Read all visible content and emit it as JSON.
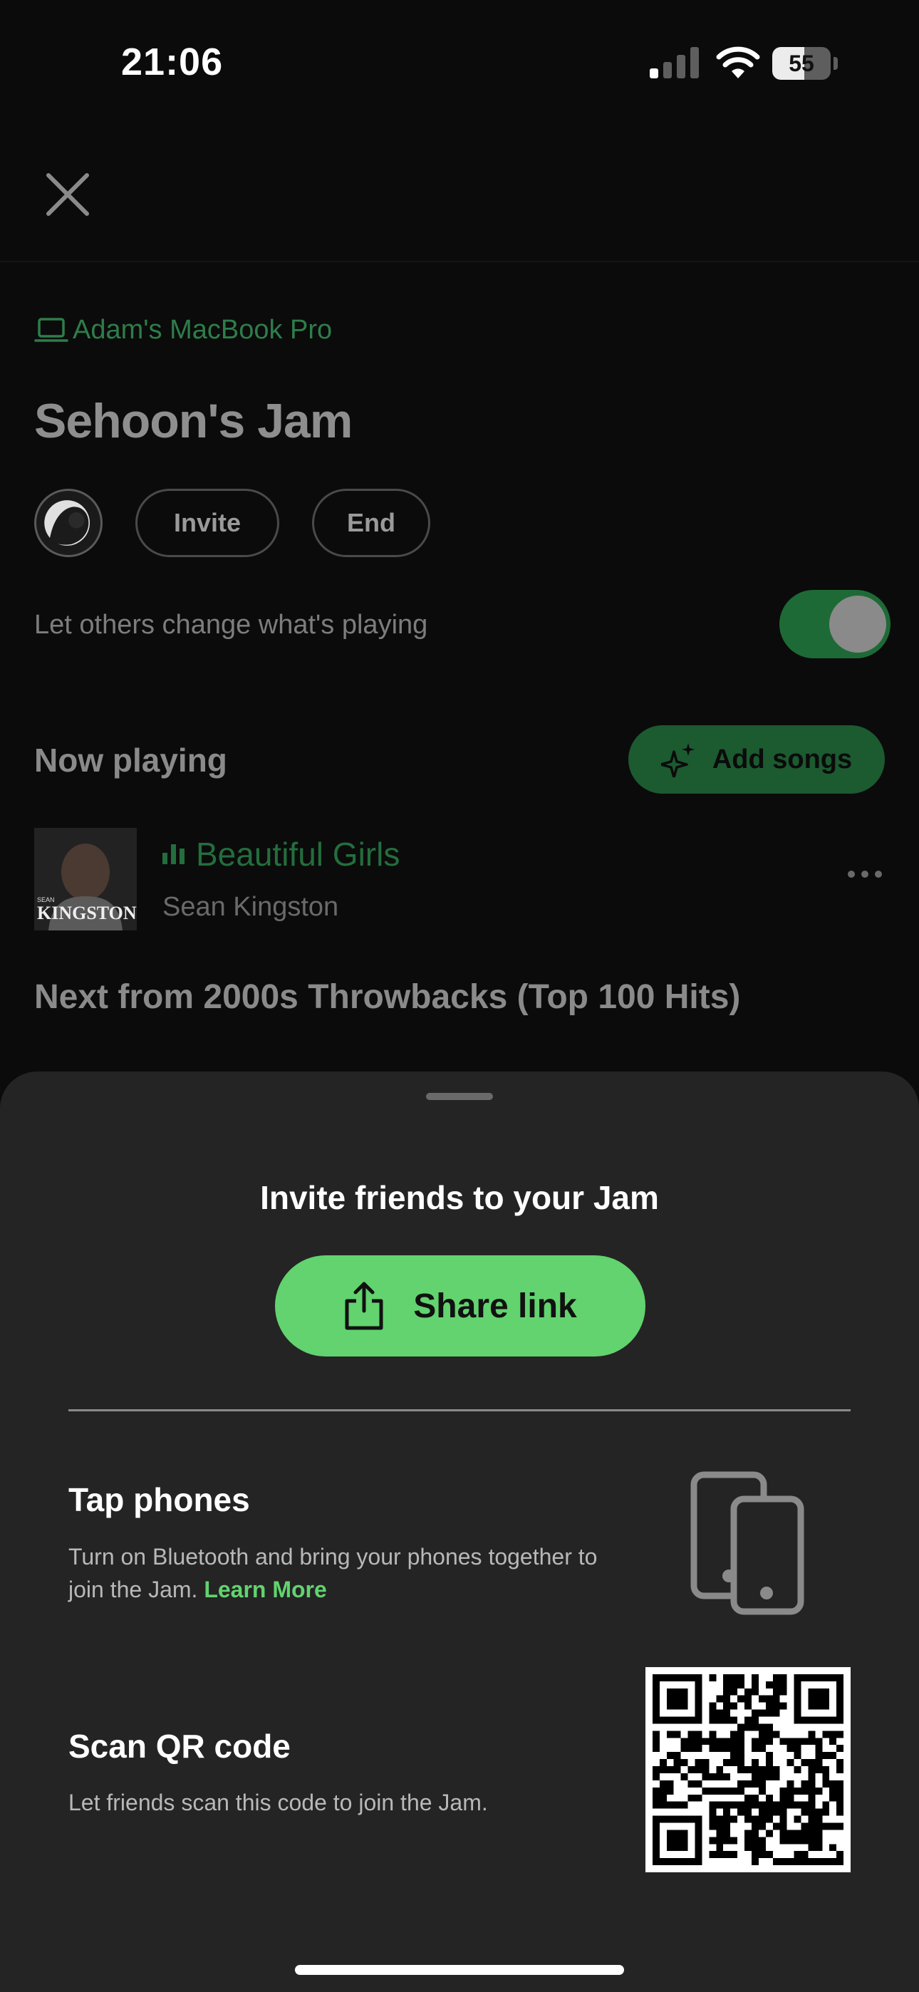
{
  "status_bar": {
    "time": "21:06",
    "battery": "55",
    "battery_level": 0.55
  },
  "jam": {
    "device": "Adam's MacBook Pro",
    "title": "Sehoon's Jam",
    "invite_label": "Invite",
    "end_label": "End",
    "permission_text": "Let others change what's playing",
    "permission_on": true,
    "now_playing_label": "Now playing",
    "add_songs_label": "Add songs",
    "track": {
      "title": "Beautiful Girls",
      "artist": "Sean Kingston",
      "cover_text": "KINGSTON",
      "cover_small": "SEAN"
    },
    "next_from": "Next from 2000s Throwbacks (Top 100 Hits)"
  },
  "sheet": {
    "title": "Invite friends to your Jam",
    "share_label": "Share link",
    "tap_title": "Tap phones",
    "tap_desc": "Turn on Bluetooth and bring your phones together to join the Jam.",
    "learn_more": "Learn More",
    "qr_title": "Scan QR code",
    "qr_desc": "Let friends scan this code to join the Jam."
  },
  "colors": {
    "accent": "#62d36e",
    "sheet_bg": "#242424",
    "bg": "#0b0b0b"
  }
}
